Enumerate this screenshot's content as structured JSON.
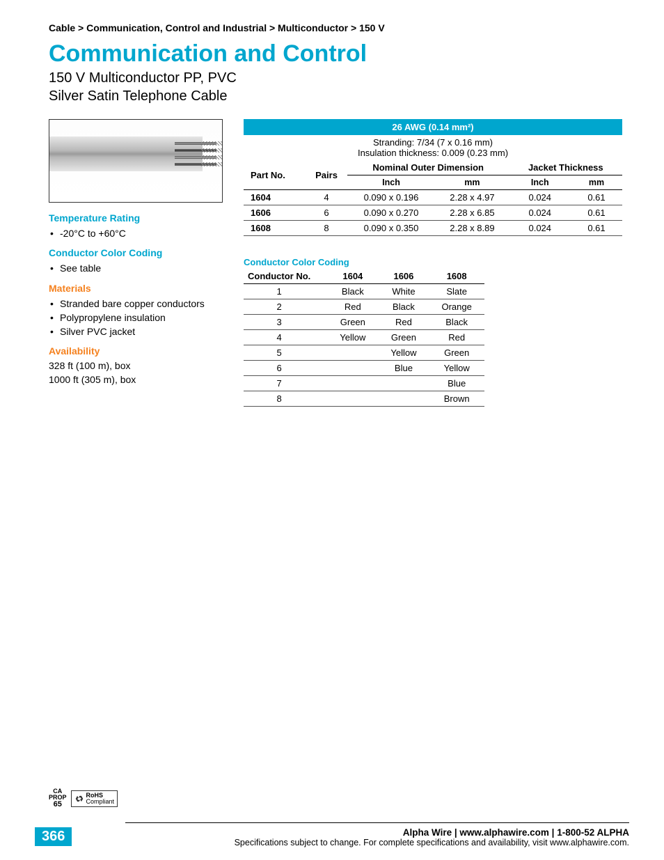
{
  "breadcrumb": "Cable > Communication, Control and Industrial > Multiconductor > 150 V",
  "title": "Communication and Control",
  "subtitle_l1": "150 V Multiconductor PP, PVC",
  "subtitle_l2": "Silver Satin Telephone Cable",
  "sections": {
    "temp": {
      "head": "Temperature Rating",
      "items": [
        "-20°C to +60°C"
      ]
    },
    "ccc": {
      "head": "Conductor Color Coding",
      "items": [
        "See table"
      ]
    },
    "mat": {
      "head": "Materials",
      "items": [
        "Stranded bare copper conductors",
        "Polypropylene insulation",
        "Silver PVC jacket"
      ]
    },
    "avail": {
      "head": "Availability",
      "lines": [
        "328 ft (100 m), box",
        "1000 ft (305 m), box"
      ]
    }
  },
  "chart_data": {
    "type": "table",
    "title": "26 AWG (0.14 mm²)",
    "sub_l1": "Stranding: 7/34 (7 x 0.16 mm)",
    "sub_l2": "Insulation thickness: 0.009 (0.23 mm)",
    "group_headers": {
      "partno": "Part No.",
      "pairs": "Pairs",
      "nod": "Nominal Outer Dimension",
      "jt": "Jacket Thickness"
    },
    "unit_headers": {
      "inch": "Inch",
      "mm": "mm"
    },
    "rows": [
      {
        "part": "1604",
        "pairs": "4",
        "nod_in": "0.090 x 0.196",
        "nod_mm": "2.28 x 4.97",
        "jt_in": "0.024",
        "jt_mm": "0.61"
      },
      {
        "part": "1606",
        "pairs": "6",
        "nod_in": "0.090 x 0.270",
        "nod_mm": "2.28 x 6.85",
        "jt_in": "0.024",
        "jt_mm": "0.61"
      },
      {
        "part": "1608",
        "pairs": "8",
        "nod_in": "0.090 x 0.350",
        "nod_mm": "2.28 x 8.89",
        "jt_in": "0.024",
        "jt_mm": "0.61"
      }
    ]
  },
  "color_coding": {
    "title": "Conductor Color Coding",
    "headers": [
      "Conductor No.",
      "1604",
      "1606",
      "1608"
    ],
    "rows": [
      [
        "1",
        "Black",
        "White",
        "Slate"
      ],
      [
        "2",
        "Red",
        "Black",
        "Orange"
      ],
      [
        "3",
        "Green",
        "Red",
        "Black"
      ],
      [
        "4",
        "Yellow",
        "Green",
        "Red"
      ],
      [
        "5",
        "",
        "Yellow",
        "Green"
      ],
      [
        "6",
        "",
        "Blue",
        "Yellow"
      ],
      [
        "7",
        "",
        "",
        "Blue"
      ],
      [
        "8",
        "",
        "",
        "Brown"
      ]
    ]
  },
  "badges": {
    "ca_top": "CA",
    "ca_mid": "PROP",
    "ca_bot": "65",
    "rohs_l1": "RoHS",
    "rohs_l2": "Compliant"
  },
  "footer": {
    "page": "366",
    "line1": "Alpha Wire | www.alphawire.com | 1-800-52 ALPHA",
    "line2": "Specifications subject to change. For complete specifications and availability, visit www.alphawire.com."
  }
}
